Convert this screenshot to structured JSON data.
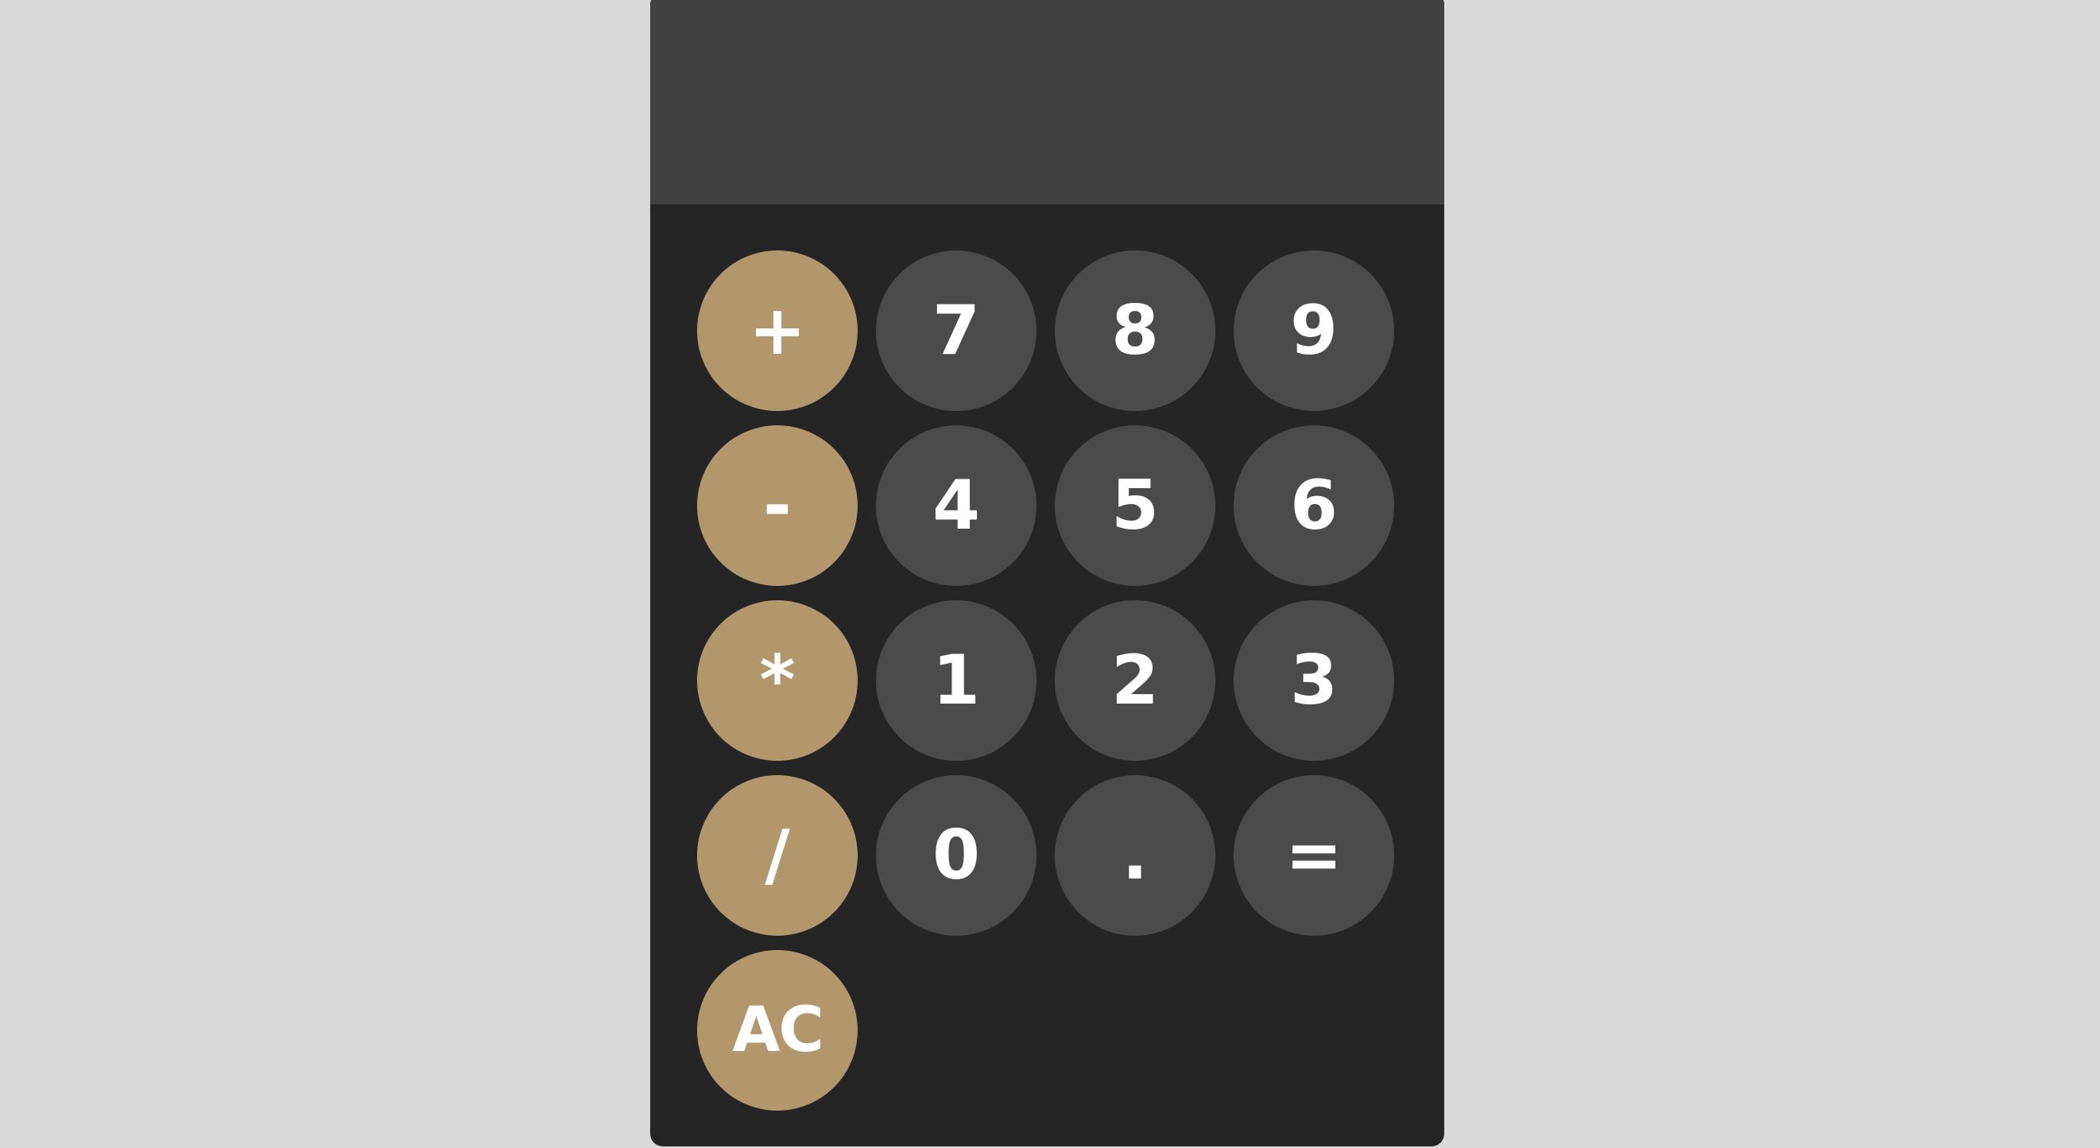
{
  "display": {
    "value": ""
  },
  "buttons": {
    "plus": "+",
    "seven": "7",
    "eight": "8",
    "nine": "9",
    "minus": "-",
    "four": "4",
    "five": "5",
    "six": "6",
    "multiply": "*",
    "one": "1",
    "two": "2",
    "three": "3",
    "divide": "/",
    "zero": "0",
    "decimal": ".",
    "equals": "=",
    "clear": "AC"
  },
  "colors": {
    "background": "#d9d9d9",
    "body": "#252525",
    "display": "#414141",
    "operator": "#b2976d",
    "number": "#4b4b4b",
    "text": "#ffffff"
  }
}
